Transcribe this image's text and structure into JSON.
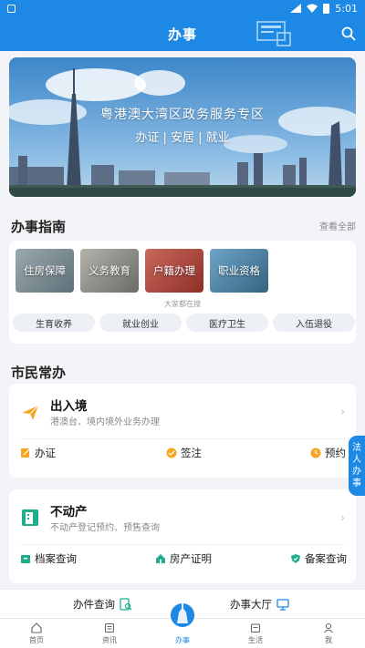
{
  "status_bar": {
    "time": "5:01"
  },
  "header": {
    "title": "办事"
  },
  "banner": {
    "title": "粤港澳大湾区政务服务专区",
    "subtitle": "办证 | 安居 | 就业"
  },
  "guide": {
    "title": "办事指南",
    "more": "查看全部",
    "tiles": [
      {
        "label": "住房保障",
        "color": "#7a8b93"
      },
      {
        "label": "义务教育",
        "color": "#8a8a85"
      },
      {
        "label": "户籍办理",
        "color": "#b0483f"
      },
      {
        "label": "职业资格",
        "color": "#4c82a6"
      }
    ],
    "hint": "大家都在搜",
    "pills": [
      "生育收养",
      "就业创业",
      "医疗卫生",
      "入伍退役"
    ]
  },
  "citizen": {
    "title": "市民常办"
  },
  "entry_exit": {
    "name": "出入境",
    "desc": "港澳台、境内境外业务办理",
    "actions": [
      "办证",
      "签注",
      "预约"
    ]
  },
  "real_estate": {
    "name": "不动产",
    "desc": "不动产登记预约、预售查询",
    "actions": [
      "档案查询",
      "房产证明",
      "备案查询"
    ]
  },
  "side_tab": [
    "法",
    "人",
    "办",
    "事"
  ],
  "quick": {
    "left": "办件查询",
    "right": "办事大厅"
  },
  "tabs": [
    {
      "label": "首页"
    },
    {
      "label": "资讯"
    },
    {
      "label": "办事"
    },
    {
      "label": "生活"
    },
    {
      "label": "我"
    }
  ],
  "colors": {
    "brand": "#1e88e5",
    "orange": "#f5a623",
    "green": "#1fae8c"
  }
}
